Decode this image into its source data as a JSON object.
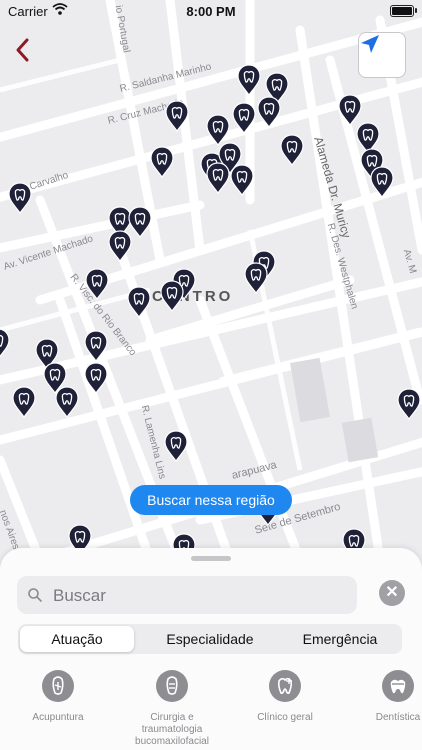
{
  "status_bar": {
    "carrier": "Carrier",
    "time": "8:00 PM"
  },
  "map": {
    "district_label": "CENTRO",
    "streets": [
      "io Portugal",
      "R. Saldanha Marinho",
      "R. Cruz Machado",
      "Alameda Dr. Muricy",
      "Carvalho",
      "Av. Vicente Machado",
      "R. Des. Westphalen",
      "R. Visc. do Rio Branco",
      "R. Lamenha Lins",
      "Av. M",
      "arapuava",
      "Sete de Setembro",
      "nos Aires"
    ]
  },
  "search_region_button": "Buscar nessa região",
  "sheet": {
    "search_placeholder": "Buscar",
    "segments": [
      "Atuação",
      "Especialidade",
      "Emergência"
    ],
    "active_segment": "Atuação",
    "categories": [
      {
        "label": "Acupuntura",
        "icon": "acupuncture-icon"
      },
      {
        "label": "Cirurgia e traumatologia bucomaxilofacial",
        "icon": "surgery-icon"
      },
      {
        "label": "Clínico geral",
        "icon": "tooth-plus-icon"
      },
      {
        "label": "Dentística",
        "icon": "tooth-crown-icon"
      }
    ]
  },
  "colors": {
    "accent_blue": "#1e88f0",
    "pin": "#1f2138",
    "back_arrow": "#8e1b24"
  }
}
